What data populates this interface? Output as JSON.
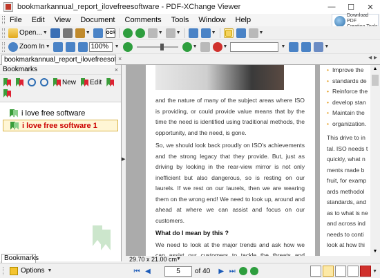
{
  "window": {
    "title": "bookmarkannual_report_ilovefreesoftware - PDF-XChange Viewer",
    "minimize": "—",
    "maximize": "☐",
    "close": "✕"
  },
  "menu": [
    "File",
    "Edit",
    "View",
    "Document",
    "Comments",
    "Tools",
    "Window",
    "Help"
  ],
  "promo": {
    "line1": "Download PDF",
    "line2": "Creation Tools"
  },
  "toolbar1": {
    "open_label": "Open...",
    "ocr_label": "OCR"
  },
  "toolbar2": {
    "zoom_in_label": "Zoom In",
    "zoom_value": "100%"
  },
  "tab": {
    "label": "bookmarkannual_report_ilovefreesoftware",
    "close": "×",
    "scroll": "◂ ▸"
  },
  "bookmarks_panel": {
    "title": "Bookmarks",
    "close": "×",
    "new_label": "New",
    "edit_label": "Edit",
    "items": [
      {
        "label": "i love free software",
        "selected": false
      },
      {
        "label": "i love free software 1",
        "selected": true
      }
    ],
    "tab_label": "Bookmarks"
  },
  "document": {
    "paragraph1": "and the nature of many of the subject areas where ISO is providing, or could provide value means that by the time the need is identified using traditional methods, the opportunity, and the need, is gone.",
    "paragraph2": "So, we should look back proudly on ISO's achievements and the strong legacy that they provide. But, just as driving by looking in the rear-view mirror is not only inefficient but also dangerous, so is resting on our laurels. If we rest on our laurels, then we are wearing them on the wrong end! We need to look up, around and ahead at where we can assist and focus on our customers.",
    "heading": "What do I mean by this ?",
    "paragraph3": "We need to look at the major trends and ask how we can assist our customers to tackle the threats and capitalize on the opportunities",
    "right_bullets": [
      "Improve the",
      "standards de",
      "Reinforce the",
      "develop stan",
      "Maintain the",
      "organization."
    ],
    "right_lines": [
      "This drive to in",
      "tal. ISO needs t",
      "quickly, what n",
      "ments made b",
      "fruit, for examp",
      "ards methodol",
      "standards, and",
      "as to what is ne",
      "and across ind",
      "needs to conti",
      "look at how thi"
    ]
  },
  "status": {
    "page_size": "29.70 x 21.00 cm"
  },
  "bottom": {
    "options_label": "Options",
    "current_page": "5",
    "page_of": "of 40"
  },
  "colors": {
    "selection_border": "#d8b34a",
    "selection_text": "#cc0000",
    "bullet": "#e39b1a",
    "nav_blue": "#1c5bb8"
  }
}
